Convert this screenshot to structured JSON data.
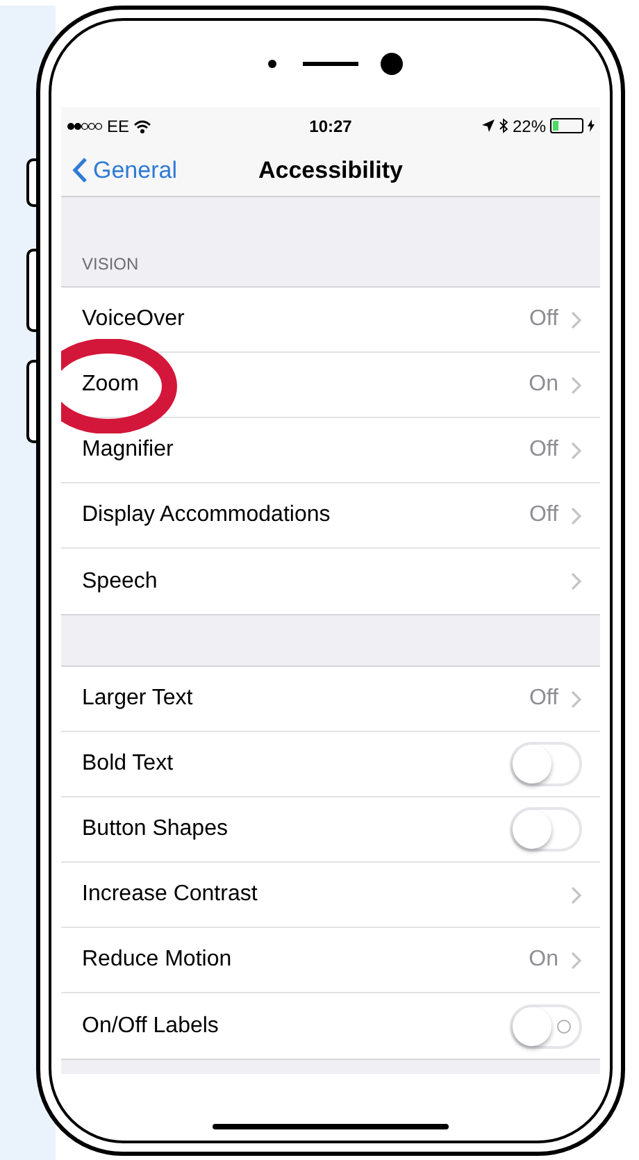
{
  "status_bar": {
    "carrier": "EE",
    "time": "10:27",
    "battery": "22%"
  },
  "nav_bar": {
    "back": "General",
    "title": "Accessibility"
  },
  "sections": [
    {
      "header": "VISION",
      "rows": [
        {
          "kind": "disclosure",
          "label": "VoiceOver",
          "value": "Off"
        },
        {
          "kind": "disclosure",
          "label": "Zoom",
          "value": "On",
          "highlighted": true
        },
        {
          "kind": "disclosure",
          "label": "Magnifier",
          "value": "Off"
        },
        {
          "kind": "disclosure",
          "label": "Display Accommodations",
          "value": "Off"
        },
        {
          "kind": "disclosure",
          "label": "Speech"
        }
      ]
    },
    {
      "rows": [
        {
          "kind": "disclosure",
          "label": "Larger Text",
          "value": "Off"
        },
        {
          "kind": "toggle",
          "label": "Bold Text",
          "on": false,
          "show_off_label": false
        },
        {
          "kind": "toggle",
          "label": "Button Shapes",
          "on": false,
          "show_off_label": false
        },
        {
          "kind": "disclosure",
          "label": "Increase Contrast"
        },
        {
          "kind": "disclosure",
          "label": "Reduce Motion",
          "value": "On"
        },
        {
          "kind": "toggle",
          "label": "On/Off Labels",
          "on": false,
          "show_off_label": true
        }
      ]
    }
  ]
}
